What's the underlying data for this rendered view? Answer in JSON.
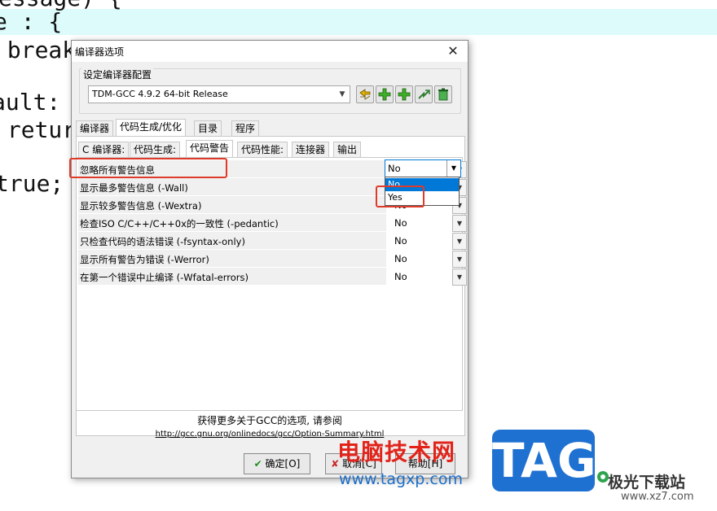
{
  "editor": {
    "lines": [
      "essage) {",
      "e : {",
      " break",
      "ault:",
      " retur",
      "true;"
    ]
  },
  "dialog": {
    "title": "编译器选项",
    "close_glyph": "✕",
    "config_group_label": "设定编译器配置",
    "compiler_selected": "TDM-GCC 4.9.2 64-bit Release",
    "toolbar_icons": [
      "rename-icon",
      "add-icon",
      "add-icon",
      "export-icon",
      "delete-icon"
    ],
    "tabs": [
      "编译器",
      "代码生成/优化",
      "目录",
      "程序"
    ],
    "active_tab": "代码生成/优化",
    "subtabs": [
      "C 编译器:",
      "代码生成:",
      "代码警告",
      "代码性能:",
      "连接器",
      "输出"
    ],
    "active_subtab": "代码警告",
    "options": [
      {
        "label": "忽略所有警告信息",
        "value": "No"
      },
      {
        "label": "显示最多警告信息 (-Wall)",
        "value": "No"
      },
      {
        "label": "显示较多警告信息 (-Wextra)",
        "value": "No"
      },
      {
        "label": "检查ISO C/C++/C++0x的一致性 (-pedantic)",
        "value": "No"
      },
      {
        "label": "只检查代码的语法错误 (-fsyntax-only)",
        "value": "No"
      },
      {
        "label": "显示所有警告为错误 (-Werror)",
        "value": "No"
      },
      {
        "label": "在第一个错误中止编译 (-Wfatal-errors)",
        "value": "No"
      }
    ],
    "dropdown_options": [
      "No",
      "Yes"
    ],
    "dropdown_selected": "No",
    "footer_text": "获得更多关于GCC的选项, 请参阅",
    "footer_link": "http://gcc.gnu.org/onlinedocs/gcc/Option-Summary.html",
    "ok_label": "确定[O]",
    "cancel_label": "取消[C]",
    "help_label": "帮助[H]"
  },
  "watermark": {
    "cn_title": "电脑技术网",
    "url": "www.tagxp.com",
    "tag": "TAG",
    "site_name": "极光下载站",
    "site_url": "www.xz7.com"
  },
  "colors": {
    "highlight_line": "#ddfbfb",
    "annotation_red": "#e03a2a",
    "selection_blue": "#0078d7",
    "tag_blue": "#1f71d1"
  }
}
